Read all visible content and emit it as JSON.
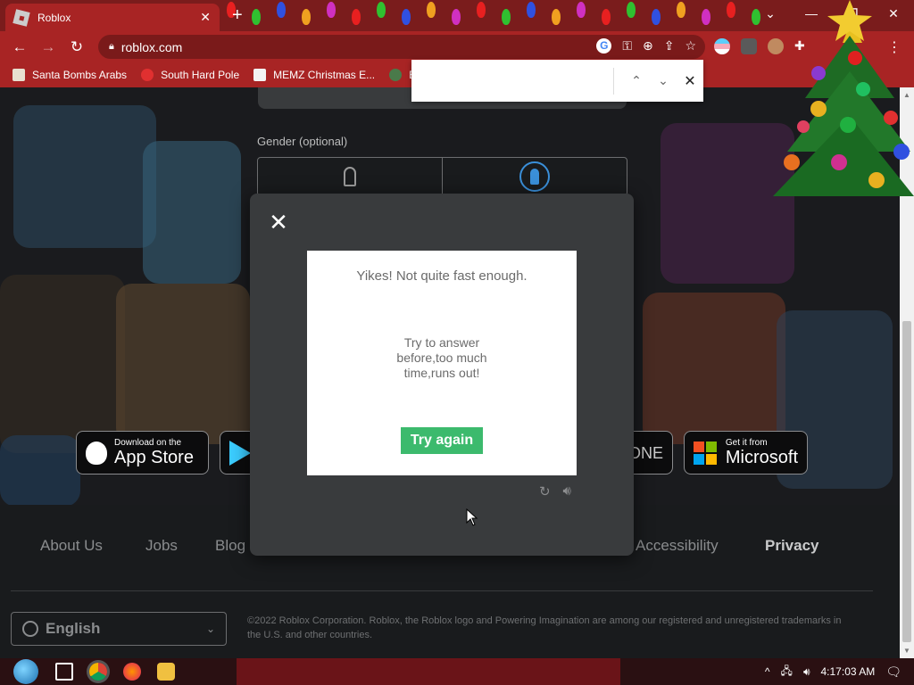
{
  "browser": {
    "tab_title": "Roblox",
    "url": "roblox.com",
    "window_controls": {
      "minimize": "—",
      "restore": "❐",
      "close": "✕"
    },
    "new_tab": "+",
    "tab_close": "✕"
  },
  "bookmarks": [
    {
      "label": "Santa Bombs Arabs",
      "icon_color": "#e8e0d0"
    },
    {
      "label": "South Hard Pole",
      "icon_color": "#e03030"
    },
    {
      "label": "MEMZ Christmas E...",
      "icon_color": "#f4f4f4"
    },
    {
      "label": "E",
      "icon_color": "#4a7a4a"
    }
  ],
  "find_bar": {
    "value": ""
  },
  "form": {
    "gender_label": "Gender (optional)"
  },
  "modal": {
    "close_icon": "✕",
    "captcha_title": "Yikes! Not quite fast enough.",
    "captcha_message": "Try to answer before,too much time,runs out!",
    "button_label": "Try again"
  },
  "stores": {
    "apple_small": "Download on the",
    "apple_big": "App Store",
    "xbox_partial": "ONE",
    "ms_small": "Get it from",
    "ms_big": "Microsoft"
  },
  "footer": {
    "links": [
      "About Us",
      "Jobs",
      "Blog",
      "Accessibility",
      "Privacy"
    ],
    "language": "English",
    "copyright": "©2022 Roblox Corporation. Roblox, the Roblox logo and Powering Imagination are among our registered and unregistered trademarks in the U.S. and other countries."
  },
  "taskbar": {
    "time": "4:17:03 AM"
  },
  "colors": {
    "chrome_red": "#a82424",
    "accent_green": "#3cba6d",
    "modal_bg": "#393b3d"
  }
}
